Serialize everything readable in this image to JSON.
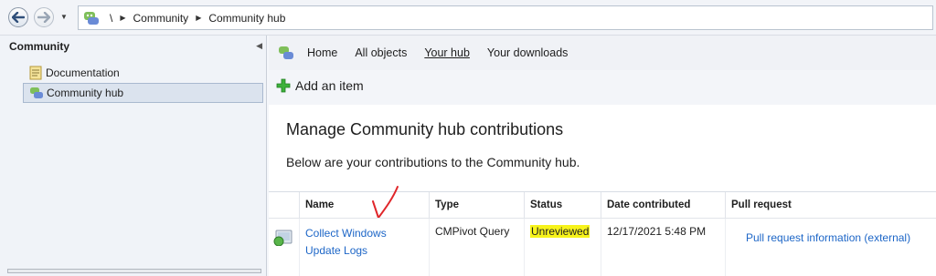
{
  "breadcrumb": {
    "root": "\\",
    "items": [
      "Community",
      "Community hub"
    ]
  },
  "navpane": {
    "header": "Community",
    "items": [
      {
        "label": "Documentation",
        "icon": "document-icon"
      },
      {
        "label": "Community hub",
        "icon": "community-hub-icon",
        "selected": true
      }
    ]
  },
  "hubnav": {
    "items": [
      {
        "label": "Home"
      },
      {
        "label": "All objects"
      },
      {
        "label": "Your hub",
        "active": true
      },
      {
        "label": "Your downloads"
      }
    ]
  },
  "toolbar": {
    "add_item_label": "Add an item"
  },
  "content": {
    "title": "Manage Community hub contributions",
    "subtitle": "Below are your contributions to the Community hub."
  },
  "table": {
    "columns": [
      "Name",
      "Type",
      "Status",
      "Date contributed",
      "Pull request"
    ],
    "rows": [
      {
        "name_line1": "Collect Windows",
        "name_line2": "Update Logs",
        "type": "CMPivot Query",
        "status": "Unreviewed",
        "date": "12/17/2021 5:48 PM",
        "pull_request": "Pull request information (external)"
      }
    ]
  },
  "colors": {
    "link": "#1d66c7",
    "status_highlight": "#f7f31b",
    "annotation": "#e0262a"
  }
}
